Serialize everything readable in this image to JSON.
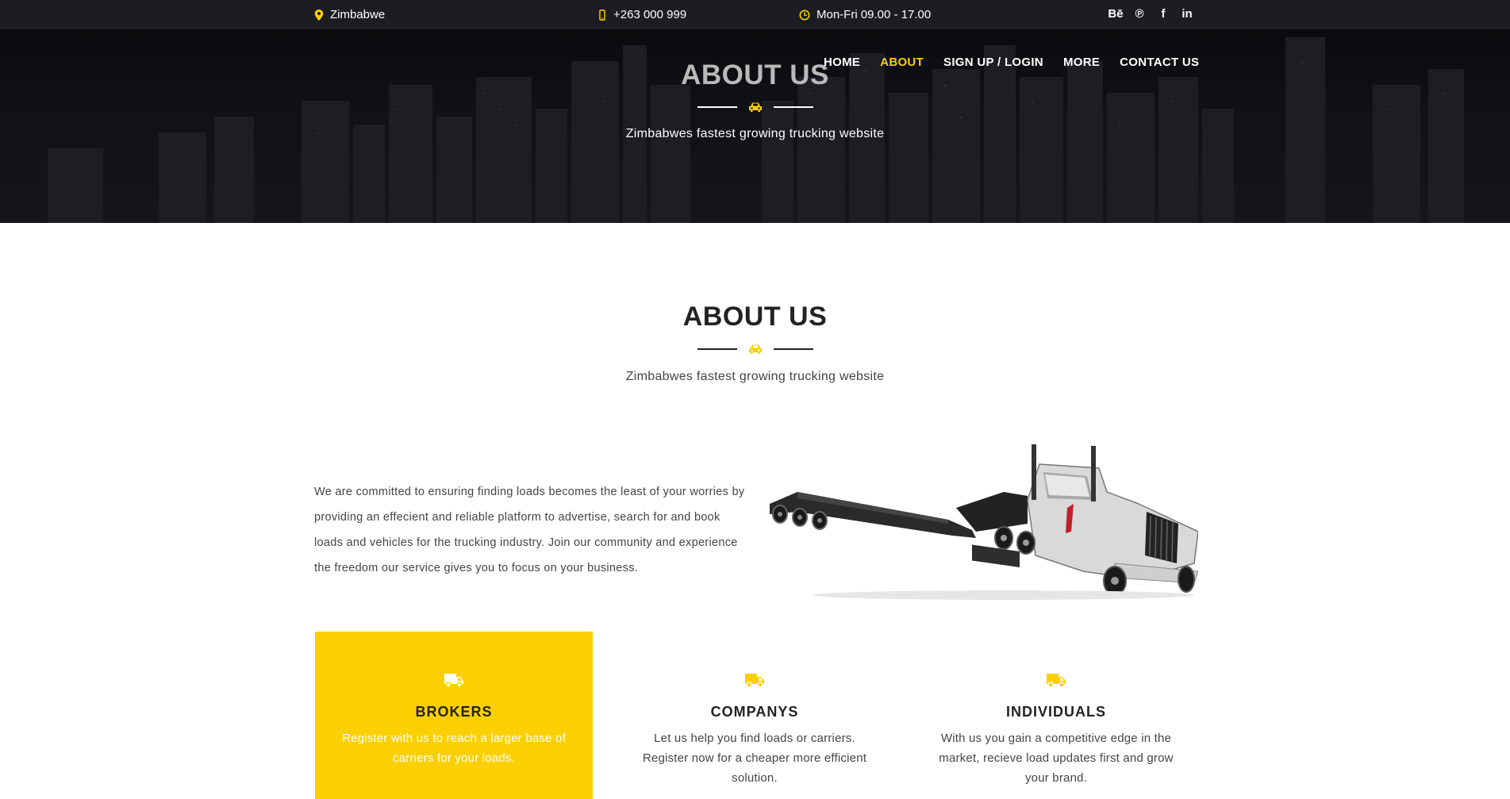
{
  "topbar": {
    "location": "Zimbabwe",
    "phone": "+263 000 999",
    "hours": "Mon-Fri 09.00 - 17.00",
    "socials": [
      {
        "icon": "behance-icon",
        "glyph": "Bē"
      },
      {
        "icon": "pinterest-icon",
        "glyph": "℗"
      },
      {
        "icon": "facebook-icon",
        "glyph": "f"
      },
      {
        "icon": "linkedin-icon",
        "glyph": "in"
      }
    ]
  },
  "nav": {
    "items": [
      {
        "label": "HOME",
        "active": false
      },
      {
        "label": "ABOUT",
        "active": true
      },
      {
        "label": "SIGN UP / LOGIN",
        "active": false
      },
      {
        "label": "MORE",
        "active": false
      },
      {
        "label": "CONTACT US",
        "active": false
      }
    ]
  },
  "hero": {
    "title": "ABOUT US",
    "subtitle": "Zimbabwes fastest growing trucking website"
  },
  "about": {
    "title": "ABOUT US",
    "subtitle": "Zimbabwes fastest growing trucking website",
    "body": "We are committed to ensuring finding loads becomes the least of your worries by providing an effecient and reliable platform to advertise, search for and book loads and vehicles for the trucking industry. Join our community and experience the freedom our service gives you to focus on your business."
  },
  "cards": [
    {
      "title": "BROKERS",
      "text": "Register with us to reach a larger base of carriers for your loads.",
      "icon": "truck-icon"
    },
    {
      "title": "COMPANYS",
      "text": "Let us help you find loads or carriers. Register now for a cheaper more efficient solution.",
      "icon": "truck-icon"
    },
    {
      "title": "INDIVIDUALS",
      "text": "With us you gain a competitive edge in the market, recieve load updates first and grow your brand.",
      "icon": "truck-icon"
    }
  ],
  "colors": {
    "accent": "#fcd000",
    "topbar": "#1b1d22",
    "text": "#222222"
  }
}
